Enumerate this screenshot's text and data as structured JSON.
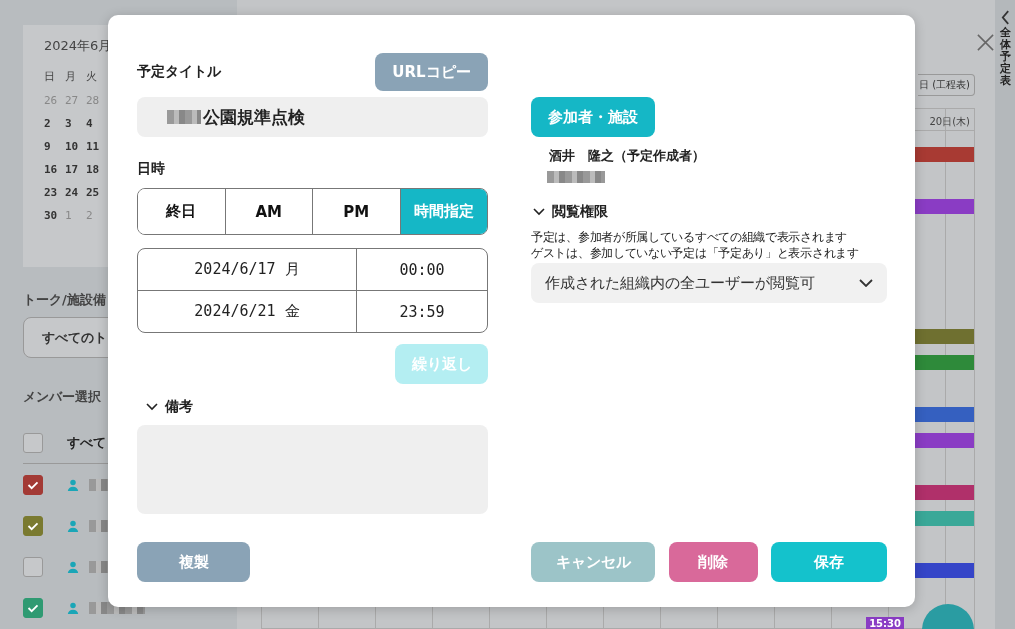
{
  "sidebar": {
    "month": "2024年6月",
    "weekdays": [
      "日",
      "月",
      "火"
    ],
    "days": [
      {
        "label": "26",
        "muted": true
      },
      {
        "label": "27",
        "muted": true
      },
      {
        "label": "28",
        "muted": true
      },
      {
        "label": "2",
        "muted": false
      },
      {
        "label": "3",
        "muted": false
      },
      {
        "label": "4",
        "muted": false
      },
      {
        "label": "9",
        "muted": false
      },
      {
        "label": "10",
        "muted": false
      },
      {
        "label": "11",
        "muted": false
      },
      {
        "label": "16",
        "muted": false
      },
      {
        "label": "17",
        "muted": false
      },
      {
        "label": "18",
        "muted": false
      },
      {
        "label": "23",
        "muted": false
      },
      {
        "label": "24",
        "muted": false
      },
      {
        "label": "25",
        "muted": false
      },
      {
        "label": "30",
        "muted": false
      },
      {
        "label": "1",
        "muted": true
      },
      {
        "label": "2",
        "muted": true
      }
    ],
    "talk_label": "トーク/施設備",
    "talk_select": "すべてのト",
    "member_label": "メンバー選択",
    "members": [
      {
        "kind": "all",
        "label": "すべて",
        "checked": false
      },
      {
        "kind": "member",
        "checked": true,
        "color": "#a33a35"
      },
      {
        "kind": "member",
        "checked": true,
        "color": "#7a7a30"
      },
      {
        "kind": "member",
        "checked": false
      },
      {
        "kind": "member",
        "checked": true,
        "color": "#2f9a72"
      }
    ]
  },
  "calendar": {
    "view_button": "日 (工程表)",
    "day_header": "20日(木)",
    "lanes": [
      {
        "kind": "event",
        "color": "#a83a33"
      },
      {
        "kind": "empty"
      },
      {
        "kind": "event",
        "color": "#8a3cc4"
      },
      {
        "kind": "empty"
      },
      {
        "kind": "empty"
      },
      {
        "kind": "empty"
      },
      {
        "kind": "empty"
      },
      {
        "kind": "event",
        "color": "#6f7030"
      },
      {
        "kind": "event",
        "color": "#2e8a3a"
      },
      {
        "kind": "empty"
      },
      {
        "kind": "event",
        "color": "#3560c0"
      },
      {
        "kind": "event",
        "color": "#8a3cc4"
      },
      {
        "kind": "empty"
      },
      {
        "kind": "event",
        "color": "#b0306a"
      },
      {
        "kind": "event",
        "color": "#3aa898"
      },
      {
        "kind": "empty"
      },
      {
        "kind": "event",
        "color": "#3545c8"
      }
    ],
    "event_label": "15:30"
  },
  "side_tab": {
    "label": "全体予定表"
  },
  "dialog": {
    "title_label": "予定タイトル",
    "url_copy": "URLコピー",
    "title_value": "公園規準点検",
    "datetime_label": "日時",
    "segments": [
      {
        "label": "終日",
        "selected": false
      },
      {
        "label": "AM",
        "selected": false
      },
      {
        "label": "PM",
        "selected": false
      },
      {
        "label": "時間指定",
        "selected": true
      }
    ],
    "dates": [
      {
        "date": "2024/6/17 月",
        "time": "00:00"
      },
      {
        "date": "2024/6/21 金",
        "time": "23:59"
      }
    ],
    "repeat": {
      "label": "繰り返し",
      "disabled": true
    },
    "notes_label": "備考",
    "notes_expanded": true,
    "participants_button": "参加者・施設",
    "organizer": "酒井　隆之（予定作成者）",
    "permission_label": "閲覧権限",
    "permission_expanded": true,
    "permission_notes": [
      "予定は、参加者が所属しているすべての組織で表示されます",
      "ゲストは、参加していない予定は「予定あり」と表示されます"
    ],
    "permission_select": "作成された組織内の全ユーザーが閲覧可",
    "buttons": [
      {
        "kind": "duplicate",
        "label": "複製"
      },
      {
        "kind": "cancel",
        "label": "キャンセル"
      },
      {
        "kind": "delete",
        "label": "削除"
      },
      {
        "kind": "save",
        "label": "保存"
      }
    ]
  }
}
